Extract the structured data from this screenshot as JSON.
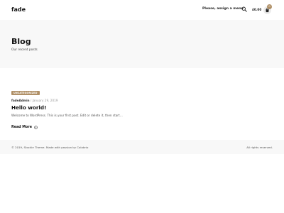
{
  "header": {
    "logo": "fade",
    "menu_notice": "Please, assign a menu",
    "search_icon": "search-icon",
    "cart_price": "£0.00",
    "cart_icon": "shopping-bag-icon",
    "cart_count": "0"
  },
  "hero": {
    "title": "Blog",
    "subtitle": "Our recent posts"
  },
  "post": {
    "category": "UNCATEGORIZED",
    "author": "fadeAdmin",
    "date": "January 29, 2019",
    "title": "Hello world!",
    "excerpt": "Welcome to WordPress. This is your first post. Edit or delete it, then start…",
    "read_more": "Read More",
    "read_more_icon": "chevron-circle-right-icon"
  },
  "footer": {
    "left": "© 2019, Stockie Theme. Made with passion by Colabrio",
    "right": "All rights reserved."
  },
  "colors": {
    "accent": "#b09067",
    "hero_background": "#f8f8f8",
    "footer_background": "#f8f8f8"
  }
}
